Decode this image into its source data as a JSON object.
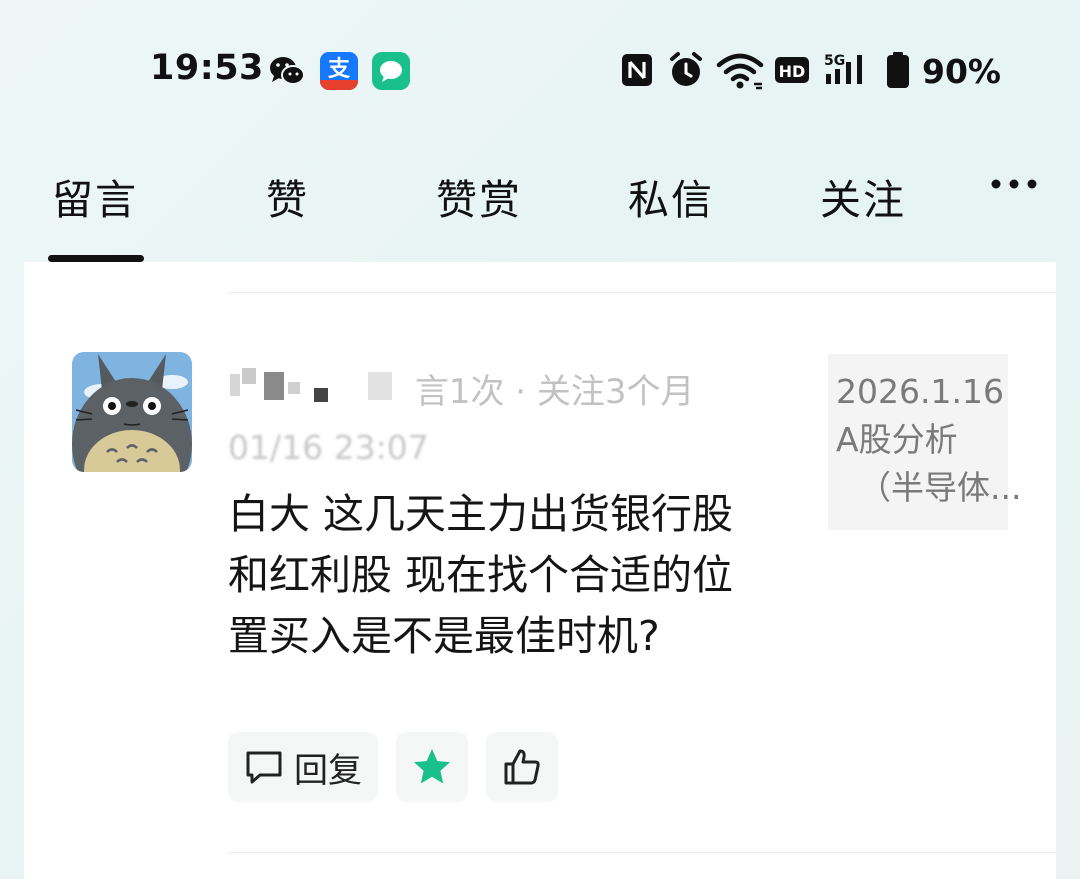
{
  "status_bar": {
    "time": "19:53",
    "battery": "90%",
    "icons": [
      "wechat-icon",
      "alipay-icon",
      "message-app-icon",
      "nfc-icon",
      "alarm-icon",
      "wifi-icon",
      "hd-icon",
      "signal-5g-icon",
      "battery-icon"
    ],
    "alipay_glyph": "支",
    "hd_label": "HD",
    "network_label": "5G"
  },
  "tabs": [
    {
      "label": "留言",
      "active": true
    },
    {
      "label": "赞",
      "active": false
    },
    {
      "label": "赞赏",
      "active": false
    },
    {
      "label": "私信",
      "active": false
    },
    {
      "label": "关注",
      "active": false
    }
  ],
  "more_icon": "more-dots-icon",
  "comment": {
    "user_meta": "言1次 · 关注3个月",
    "timestamp": "01/16 23:07",
    "text": "白大 这几天主力出货银行股和红利股 现在找个合适的位置买入是不是最佳时机?",
    "reference": {
      "line1": "2026.1.16",
      "line2": "A股分析",
      "line3": "（半导体..."
    },
    "actions": {
      "reply_label": "回复",
      "star_icon": "star-icon",
      "like_icon": "thumbs-up-icon"
    }
  },
  "colors": {
    "accent_green": "#19c08a",
    "tab_underline": "#111111",
    "background": "#e9f5f4"
  }
}
